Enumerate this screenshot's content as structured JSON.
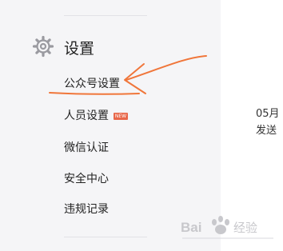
{
  "sidebar": {
    "section_title": "设置",
    "section_icon": "gear-icon",
    "items": [
      {
        "label": "公众号设置",
        "highlighted": true
      },
      {
        "label": "人员设置",
        "badge": "NEW"
      },
      {
        "label": "微信认证"
      },
      {
        "label": "安全中心"
      },
      {
        "label": "违规记录"
      }
    ]
  },
  "main": {
    "line1": "05月",
    "line2": "发送"
  },
  "annotation": {
    "color": "#f0763a"
  },
  "watermark": {
    "brand": "Baidu 经验"
  }
}
